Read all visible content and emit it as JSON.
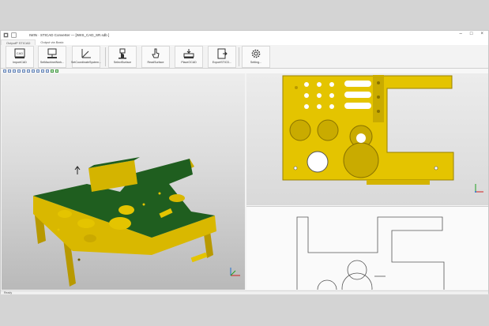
{
  "window": {
    "title": "IWIN · STICAD Converter — [IWIS_CAD_SR.sdb ]",
    "controls": {
      "minimize": "–",
      "maximize": "□",
      "close": "×"
    }
  },
  "tabs": [
    {
      "label": "OutputP STICAD"
    },
    {
      "label": "Output via Basic"
    }
  ],
  "ribbon": {
    "buttons": [
      {
        "label": "ImportCAD",
        "icon": "import-cad-icon"
      },
      {
        "label": "SetMachineWork...",
        "icon": "machine-icon"
      },
      {
        "label": "SetCoordinateSystem...",
        "icon": "coordinate-icon"
      },
      {
        "label": "SelectSurface",
        "icon": "select-surface-icon"
      },
      {
        "label": "ReadSurface",
        "icon": "read-surface-icon"
      },
      {
        "label": "PlaceOCAD",
        "icon": "place-cad-icon"
      },
      {
        "label": "ExportSTICD...",
        "icon": "export-icon"
      },
      {
        "label": "Setting...",
        "icon": "gear-icon"
      }
    ]
  },
  "status": {
    "text": "Ready"
  },
  "colors": {
    "part_face": "#e4c400",
    "part_top": "#1f5e1f",
    "accent": "#1f6fd0"
  }
}
